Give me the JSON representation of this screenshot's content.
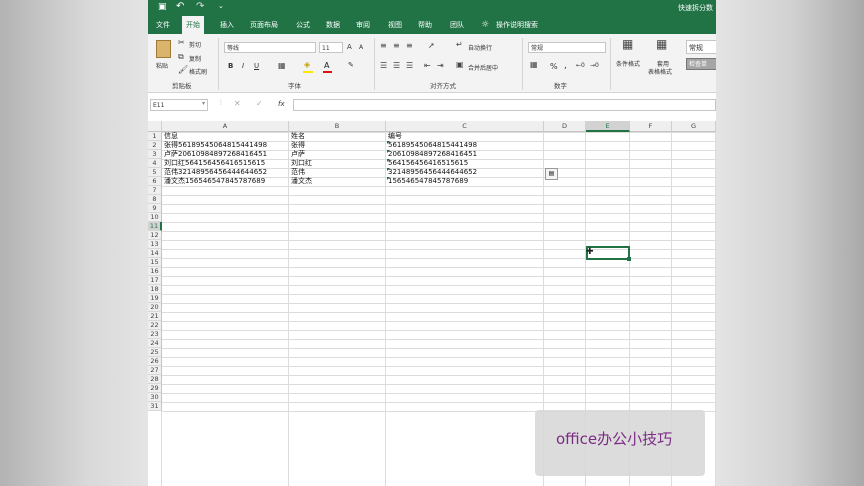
{
  "window": {
    "title": "快速拆分数"
  },
  "quick_access": {
    "save_icon": "save-icon",
    "undo_icon": "undo-icon",
    "redo_icon": "redo-icon"
  },
  "tabs": [
    "文件",
    "开始",
    "插入",
    "页面布局",
    "公式",
    "数据",
    "审阅",
    "视图",
    "帮助",
    "团队"
  ],
  "active_tab": "开始",
  "tell_me": "操作说明搜索",
  "ribbon": {
    "clipboard": {
      "paste": "粘贴",
      "cut": "剪切",
      "copy": "复制",
      "format_painter": "格式刷",
      "group_label": "剪贴板"
    },
    "font": {
      "name": "等线",
      "size": "11",
      "bold": "B",
      "italic": "I",
      "underline": "U",
      "grow": "A",
      "shrink": "A",
      "color_letter": "A",
      "group_label": "字体"
    },
    "alignment": {
      "wrap": "自动换行",
      "merge": "合并后居中",
      "group_label": "对齐方式"
    },
    "number": {
      "format": "常规",
      "percent": "%",
      "comma": ",",
      "group_label": "数字"
    },
    "styles": {
      "conditional": "条件格式",
      "table_format_line1": "套用",
      "table_format_line2": "表格格式",
      "style_normal": "常规",
      "style_check": "检查单"
    }
  },
  "formula_bar": {
    "name_box": "E11",
    "fx": "fx",
    "value": ""
  },
  "columns": [
    "A",
    "B",
    "C",
    "D",
    "E",
    "F",
    "G"
  ],
  "rows": [
    "1",
    "2",
    "3",
    "4",
    "5",
    "6",
    "7",
    "8",
    "9",
    "10",
    "11",
    "12",
    "13",
    "14",
    "15",
    "16",
    "17",
    "18",
    "19",
    "20",
    "21",
    "22",
    "23",
    "24",
    "25",
    "26",
    "27",
    "28",
    "29",
    "30",
    "31"
  ],
  "cells": [
    {
      "a": "信息",
      "b": "姓名",
      "c": "编号"
    },
    {
      "a": "张得56189545064815441498",
      "b": "张得",
      "c": "56189545064815441498"
    },
    {
      "a": "卢萨20610984897268416451",
      "b": "卢萨",
      "c": "20610984897268416451"
    },
    {
      "a": "刘口红564156456416515615",
      "b": "刘口红",
      "c": "564156456416515615"
    },
    {
      "a": "范伟32148956456444644652",
      "b": "范伟",
      "c": "32148956456444644652"
    },
    {
      "a": "潘文杰156546547845787689",
      "b": "潘文杰",
      "c": "156546547845787689"
    }
  ],
  "selected_cell": "E11",
  "accent_color": "#217346",
  "watermark": "office办公小技巧"
}
